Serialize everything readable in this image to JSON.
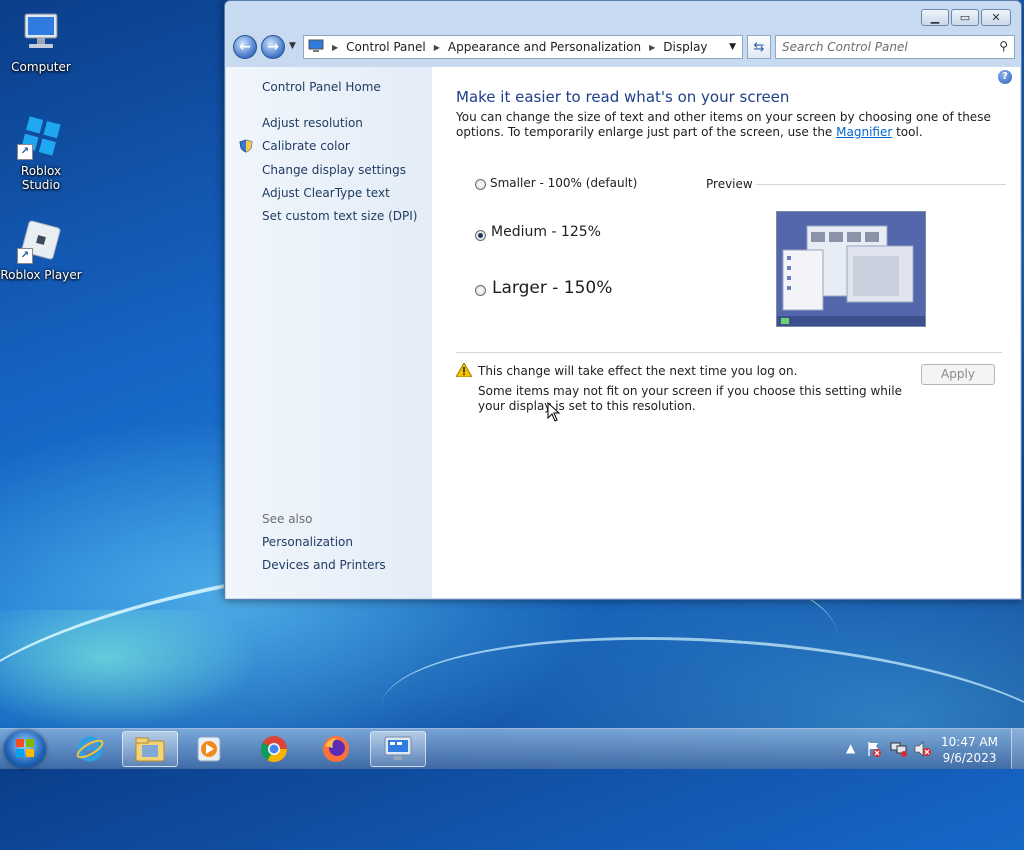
{
  "desktop": {
    "icons": [
      {
        "label": "Computer"
      },
      {
        "label": "Roblox Studio"
      },
      {
        "label": "Roblox Player"
      }
    ]
  },
  "window": {
    "address": {
      "segments": [
        "Control Panel",
        "Appearance and Personalization",
        "Display"
      ]
    },
    "search_placeholder": "Search Control Panel",
    "left_pane": {
      "home": "Control Panel Home",
      "links": [
        "Adjust resolution",
        "Calibrate color",
        "Change display settings",
        "Adjust ClearType text",
        "Set custom text size (DPI)"
      ],
      "see_also_heading": "See also",
      "see_also": [
        "Personalization",
        "Devices and Printers"
      ]
    },
    "main": {
      "title": "Make it easier to read what's on your screen",
      "description_pre": "You can change the size of text and other items on your screen by choosing one of these options. To temporarily enlarge just part of the screen, use the ",
      "description_link": "Magnifier",
      "description_post": " tool.",
      "options": [
        {
          "label": "Smaller - 100% (default)",
          "selected": false
        },
        {
          "label": "Medium - 125%",
          "selected": true
        },
        {
          "label": "Larger - 150%",
          "selected": false
        }
      ],
      "preview_label": "Preview",
      "notice": "This change will take effect the next time you log on.",
      "warning": "Some items may not fit on your screen if you choose this setting while your display is set to this resolution.",
      "apply_label": "Apply"
    }
  },
  "taskbar": {
    "time": "10:47 AM",
    "date": "9/6/2023"
  },
  "colors": {
    "title_blue": "#1e3f8a",
    "link_blue": "#0066cc",
    "window_frame": "#c7daf0"
  }
}
